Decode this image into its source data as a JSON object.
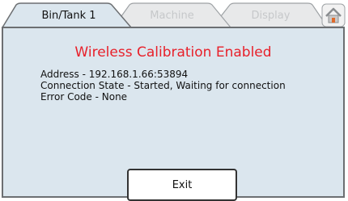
{
  "tabs": [
    {
      "label": "Bin/Tank 1",
      "active": true
    },
    {
      "label": "Machine",
      "active": false
    },
    {
      "label": "Display",
      "active": false
    }
  ],
  "home_icon": "home-icon",
  "dialog": {
    "title": "Wireless Calibration Enabled",
    "address": "Address - 192.168.1.66:53894",
    "connection_state": "Connection State - Started, Waiting for connection",
    "error_code": "Error Code - None",
    "exit_label": "Exit"
  },
  "colors": {
    "title": "#e8202a",
    "panel_bg": "#dbe6ee",
    "inactive_tab_text": "#c6c8ca"
  }
}
